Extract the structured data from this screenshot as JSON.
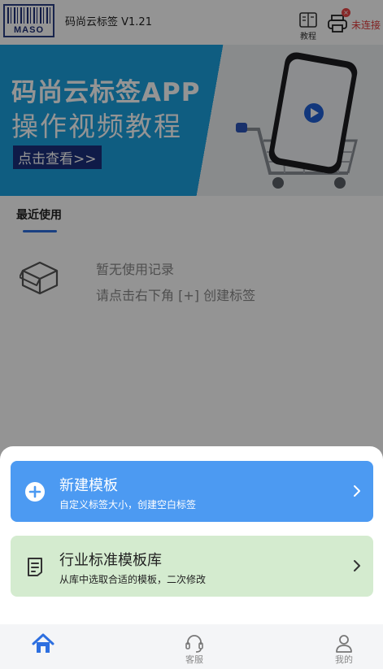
{
  "header": {
    "logo_text": "MASO",
    "app_title": "码尚云标签 V1.21",
    "tutorial_label": "教程",
    "printer_status": "未连接",
    "printer_badge": "×"
  },
  "banner": {
    "line1": "码尚云标签APP",
    "line2": "操作视频教程",
    "cta": "点击查看>>"
  },
  "recent": {
    "tab_label": "最近使用",
    "empty_line1": "暂无使用记录",
    "empty_line2": "请点击右下角 [+] 创建标签"
  },
  "sheet": {
    "new_template": {
      "title": "新建模板",
      "subtitle": "自定义标签大小，创建空白标签"
    },
    "template_library": {
      "title": "行业标准模板库",
      "subtitle": "从库中选取合适的模板，二次修改"
    }
  },
  "nav": {
    "home_label": "",
    "service_label": "客服",
    "mine_label": "我的"
  },
  "colors": {
    "accent_blue": "#4c9af2",
    "banner_blue": "#1aa1df",
    "library_green": "#d4ebcf",
    "status_red": "#e03a3a",
    "nav_home_active": "#2d6fe0"
  }
}
